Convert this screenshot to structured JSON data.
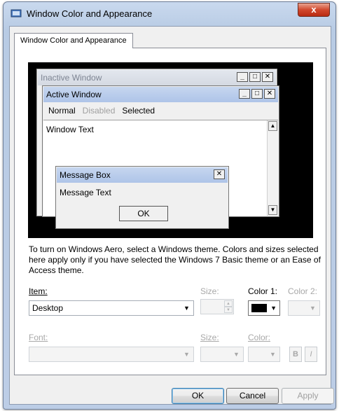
{
  "window": {
    "title": "Window Color and Appearance",
    "close_label": "x"
  },
  "tab": {
    "label": "Window Color and Appearance"
  },
  "preview": {
    "inactive_title": "Inactive Window",
    "active_title": "Active Window",
    "caption_min": "_",
    "caption_max": "□",
    "caption_close": "✕",
    "menu": {
      "normal": "Normal",
      "disabled": "Disabled",
      "selected": "Selected"
    },
    "window_text": "Window Text",
    "message_box": {
      "title": "Message Box",
      "close": "✕",
      "text": "Message Text",
      "ok": "OK"
    }
  },
  "description": "To turn on Windows Aero, select a Windows theme.  Colors and sizes selected here apply only if you have selected the Windows 7 Basic theme or an Ease of Access theme.",
  "item_row": {
    "item_label": "Item:",
    "item_value": "Desktop",
    "size_label": "Size:",
    "color1_label": "Color 1:",
    "color1_value": "#000000",
    "color2_label": "Color 2:"
  },
  "font_row": {
    "font_label": "Font:",
    "size_label": "Size:",
    "color_label": "Color:",
    "bold_label": "B",
    "italic_label": "I"
  },
  "buttons": {
    "ok": "OK",
    "cancel": "Cancel",
    "apply": "Apply"
  }
}
